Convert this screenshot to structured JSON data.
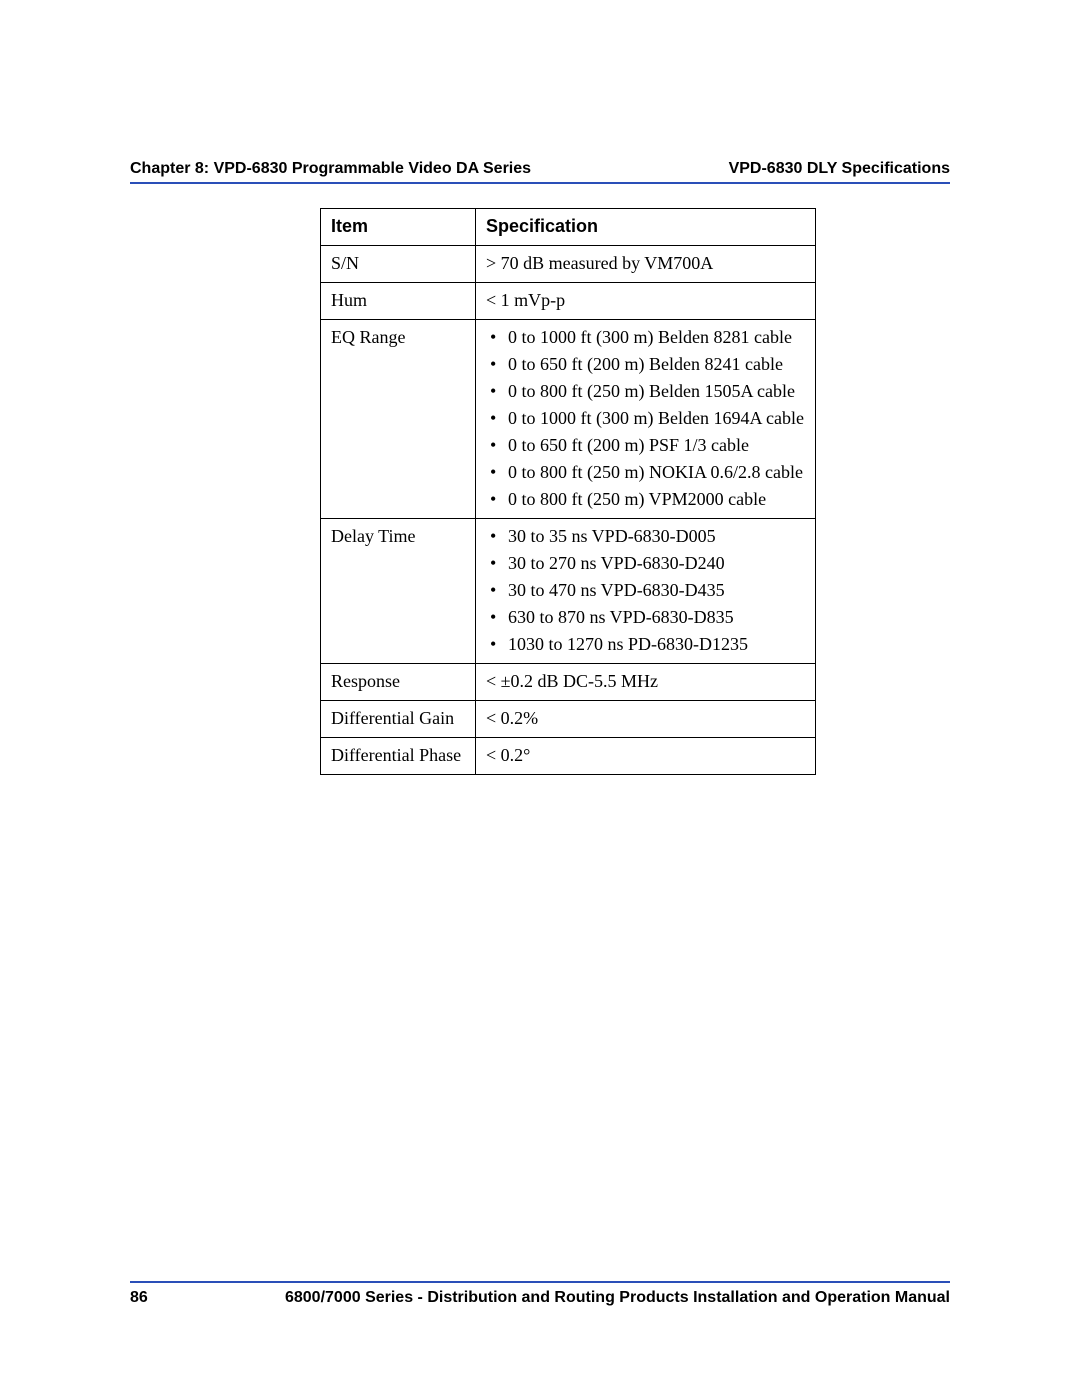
{
  "header": {
    "left": "Chapter 8: VPD-6830 Programmable Video DA Series",
    "right": "VPD-6830 DLY Specifications"
  },
  "table": {
    "headers": {
      "item": "Item",
      "spec": "Specification"
    },
    "rows": [
      {
        "item": "S/N",
        "spec_text": "> 70 dB measured by VM700A"
      },
      {
        "item": "Hum",
        "spec_text": "< 1 mVp-p"
      },
      {
        "item": "EQ Range",
        "spec_list": [
          "0 to 1000 ft (300 m) Belden 8281 cable",
          "0 to 650 ft (200 m) Belden 8241 cable",
          "0 to 800 ft (250 m) Belden 1505A cable",
          "0 to 1000 ft (300 m) Belden 1694A cable",
          "0 to 650 ft (200 m) PSF 1/3 cable",
          "0 to 800 ft (250 m) NOKIA 0.6/2.8 cable",
          "0 to 800 ft (250 m) VPM2000 cable"
        ]
      },
      {
        "item": "Delay Time",
        "spec_list": [
          "30 to 35 ns VPD-6830-D005",
          "30 to 270 ns VPD-6830-D240",
          "30 to 470 ns VPD-6830-D435",
          "630 to 870 ns VPD-6830-D835",
          "1030 to 1270 ns PD-6830-D1235"
        ]
      },
      {
        "item": "Response",
        "spec_text": "< ±0.2 dB   DC-5.5 MHz"
      },
      {
        "item": "Differential Gain",
        "spec_text": "< 0.2%"
      },
      {
        "item": "Differential Phase",
        "spec_text": "< 0.2°"
      }
    ]
  },
  "footer": {
    "page_number": "86",
    "manual_title": "6800/7000 Series - Distribution and Routing Products Installation and Operation Manual"
  }
}
